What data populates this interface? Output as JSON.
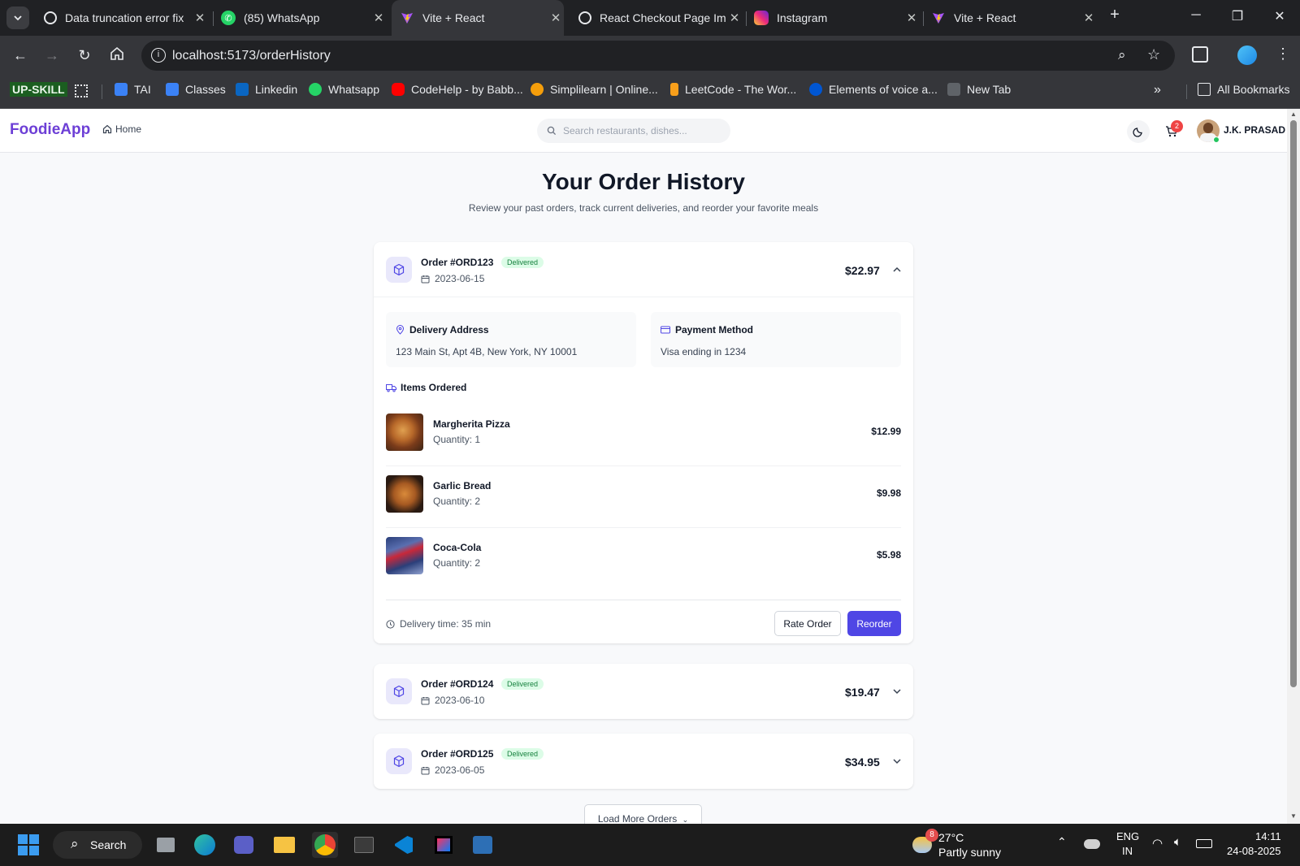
{
  "browser": {
    "tabs": [
      {
        "title": "Data truncation error fix",
        "icon": "chatgpt-icon"
      },
      {
        "title": "(85) WhatsApp",
        "icon": "whatsapp-icon"
      },
      {
        "title": "Vite + React",
        "icon": "vite-icon"
      },
      {
        "title": "React Checkout Page Im",
        "icon": "grok-icon"
      },
      {
        "title": "Instagram",
        "icon": "instagram-icon"
      },
      {
        "title": "Vite + React",
        "icon": "vite-icon"
      }
    ],
    "url": "localhost:5173/orderHistory",
    "bookmarks": [
      {
        "label": "UP-SKILL"
      },
      {
        "label": "TAI"
      },
      {
        "label": "Classes"
      },
      {
        "label": "Linkedin"
      },
      {
        "label": "Whatsapp"
      },
      {
        "label": "CodeHelp - by Babb..."
      },
      {
        "label": "Simplilearn | Online..."
      },
      {
        "label": "LeetCode - The Wor..."
      },
      {
        "label": "Elements of voice a..."
      },
      {
        "label": "New Tab"
      }
    ],
    "all_bookmarks_label": "All Bookmarks"
  },
  "app": {
    "logo": "FoodieApp",
    "home_label": "Home",
    "search_placeholder": "Search restaurants, dishes...",
    "cart_count": "2",
    "user_name": "J.K. PRASAD",
    "accent_color": "#4f46e5"
  },
  "page": {
    "title": "Your Order History",
    "subtitle": "Review your past orders, track current deliveries, and reorder your favorite meals",
    "load_more_label": "Load More Orders"
  },
  "orders": [
    {
      "id": "Order #ORD123",
      "status": "Delivered",
      "date": "2023-06-15",
      "total": "$22.97",
      "expanded": true,
      "address_label": "Delivery Address",
      "address": "123 Main St, Apt 4B, New York, NY 10001",
      "payment_label": "Payment Method",
      "payment": "Visa ending in 1234",
      "items_label": "Items Ordered",
      "items": [
        {
          "name": "Margherita Pizza",
          "qty": "Quantity: 1",
          "price": "$12.99"
        },
        {
          "name": "Garlic Bread",
          "qty": "Quantity: 2",
          "price": "$9.98"
        },
        {
          "name": "Coca-Cola",
          "qty": "Quantity: 2",
          "price": "$5.98"
        }
      ],
      "delivery_time": "Delivery time: 35 min",
      "rate_label": "Rate Order",
      "reorder_label": "Reorder"
    },
    {
      "id": "Order #ORD124",
      "status": "Delivered",
      "date": "2023-06-10",
      "total": "$19.47",
      "expanded": false
    },
    {
      "id": "Order #ORD125",
      "status": "Delivered",
      "date": "2023-06-05",
      "total": "$34.95",
      "expanded": false
    }
  ],
  "taskbar": {
    "search_label": "Search",
    "weather_temp": "27°C",
    "weather_desc": "Partly sunny",
    "weather_badge": "8",
    "lang_top": "ENG",
    "lang_bottom": "IN",
    "time": "14:11",
    "date": "24-08-2025"
  }
}
